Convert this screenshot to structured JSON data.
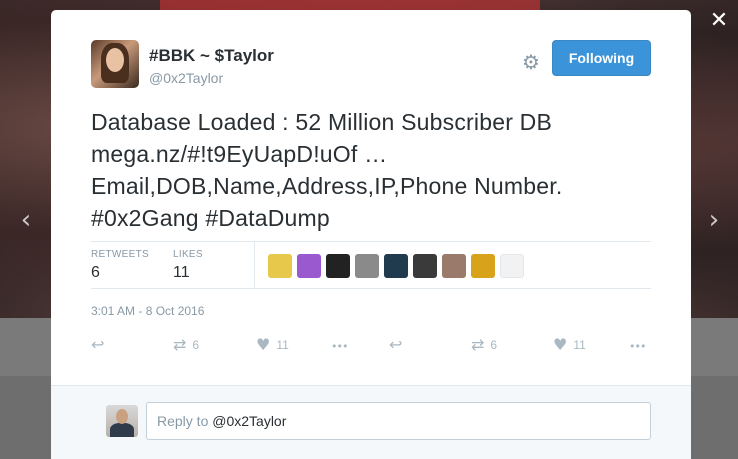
{
  "tweet": {
    "display_name": "#BBK ~ $Taylor",
    "screen_name": "@0x2Taylor",
    "follow_button": "Following",
    "text_lines": [
      "Database Loaded : 52 Million Subscriber DB",
      "mega.nz/#!t9EyUapD!uOf …",
      "Email,DOB,Name,Address,IP,Phone Number.",
      "#0x2Gang #DataDump"
    ],
    "stats": {
      "retweets_label": "RETWEETS",
      "retweets_count": "6",
      "likes_label": "LIKES",
      "likes_count": "11"
    },
    "likers": [
      {
        "icon": "avatar-cartoon",
        "color": "#e8c84a"
      },
      {
        "icon": "avatar-purple",
        "color": "#9b59d0"
      },
      {
        "icon": "avatar-pixel",
        "color": "#222222"
      },
      {
        "icon": "avatar-grey",
        "color": "#8a8a8a"
      },
      {
        "icon": "avatar-person",
        "color": "#1f3b4d"
      },
      {
        "icon": "avatar-dark",
        "color": "#3a3a3a"
      },
      {
        "icon": "avatar-photo",
        "color": "#9a7a6a"
      },
      {
        "icon": "avatar-tomato",
        "color": "#d9a21b"
      },
      {
        "icon": "avatar-rabbit",
        "color": "#f2f2f2"
      }
    ],
    "timestamp": "3:01 AM - 8 Oct 2016",
    "actions": [
      {
        "icon": "reply-icon",
        "glyph": "↩",
        "count": ""
      },
      {
        "icon": "retweet-icon",
        "glyph": "⇄",
        "count": "6"
      },
      {
        "icon": "like-icon",
        "glyph": "♥",
        "count": "11"
      },
      {
        "icon": "more-icon",
        "glyph": "•••",
        "count": ""
      },
      {
        "icon": "reply-icon",
        "glyph": "↩",
        "count": ""
      },
      {
        "icon": "retweet-icon",
        "glyph": "⇄",
        "count": "6"
      },
      {
        "icon": "like-icon",
        "glyph": "♥",
        "count": "11"
      },
      {
        "icon": "more-icon",
        "glyph": "•••",
        "count": ""
      }
    ]
  },
  "reply": {
    "prefix": "Reply to ",
    "mention": "@0x2Taylor"
  },
  "controls": {
    "close_glyph": "✕",
    "prev_glyph": "‹",
    "next_glyph": "›",
    "gear_glyph": "⚙"
  },
  "colors": {
    "accent": "#3b94d9",
    "muted": "#8899a6",
    "text": "#292f33"
  }
}
